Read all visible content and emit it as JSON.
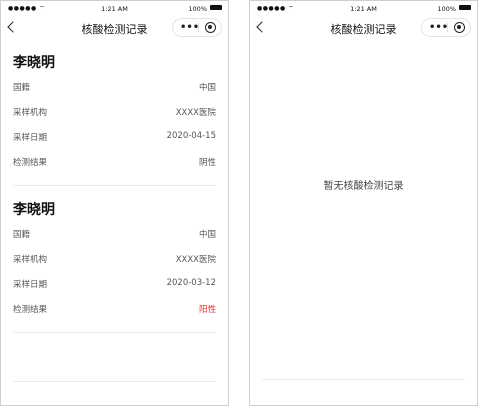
{
  "status_bar": {
    "signal": "●●●●● ⌔",
    "time": "1:21 AM",
    "battery": "100%"
  },
  "nav": {
    "title": "核酸检测记录",
    "more": "•••"
  },
  "records": [
    {
      "name": "李晓明",
      "fields": [
        {
          "label": "国籍",
          "value": "中国"
        },
        {
          "label": "采样机构",
          "value": "XXXX医院"
        },
        {
          "label": "采样日期",
          "value": "2020-04-15"
        },
        {
          "label": "检测结果",
          "value": "阴性"
        }
      ]
    },
    {
      "name": "李晓明",
      "fields": [
        {
          "label": "国籍",
          "value": "中国"
        },
        {
          "label": "采样机构",
          "value": "XXXX医院"
        },
        {
          "label": "采样日期",
          "value": "2020-03-12"
        },
        {
          "label": "检测结果",
          "value": "阳性"
        }
      ]
    }
  ],
  "empty_state": {
    "message": "暂无核酸检测记录"
  },
  "colors": {
    "positive": "#e5322d",
    "text": "#111111",
    "muted": "#555555"
  }
}
